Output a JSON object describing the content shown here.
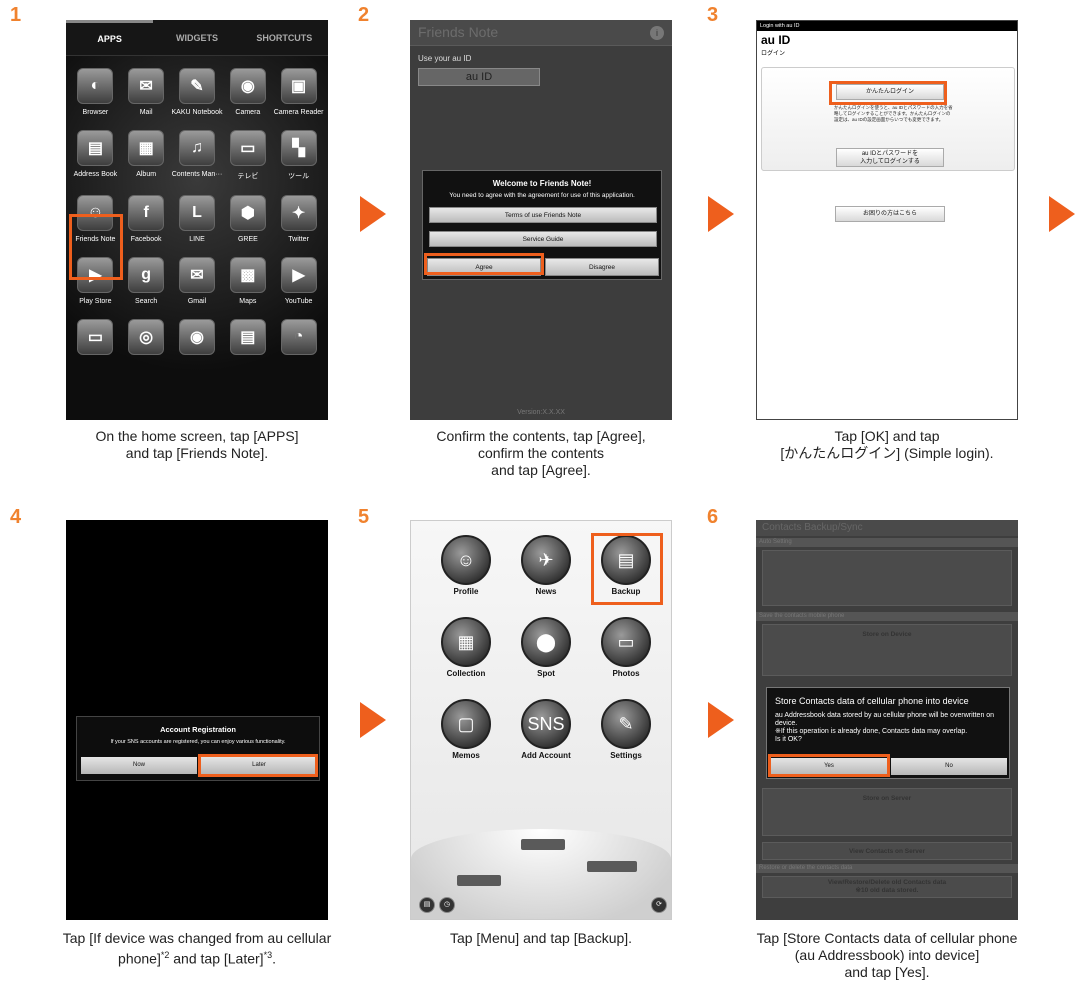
{
  "steps": [
    {
      "num": "1",
      "caption": [
        "On the home screen, tap [APPS]",
        "and tap [Friends Note]."
      ]
    },
    {
      "num": "2",
      "caption": [
        "Confirm the contents, tap [Agree],",
        "confirm the contents",
        "and tap [Agree]."
      ]
    },
    {
      "num": "3",
      "caption": [
        "Tap [OK] and tap",
        "[かんたんログイン] (Simple login)."
      ]
    },
    {
      "num": "4",
      "caption_a": "Tap [If device was changed from au cellular",
      "caption_b1": "phone]",
      "sup1": "*2",
      "caption_b2": " and tap [Later]",
      "sup2": "*3",
      "caption_b3": "."
    },
    {
      "num": "5",
      "caption": [
        "Tap [Menu] and tap [Backup]."
      ]
    },
    {
      "num": "6",
      "caption": [
        "Tap [Store Contacts data of cellular phone",
        "(au Addressbook) into device]",
        "and tap [Yes]."
      ]
    }
  ],
  "s1": {
    "tabs": [
      "APPS",
      "WIDGETS",
      "SHORTCUTS"
    ],
    "apps": [
      {
        "label": "Browser",
        "glyph": "◐"
      },
      {
        "label": "Mail",
        "glyph": "✉"
      },
      {
        "label": "KAKU Notebook",
        "glyph": "✎"
      },
      {
        "label": "Camera",
        "glyph": "◉"
      },
      {
        "label": "Camera Reader",
        "glyph": "▣"
      },
      {
        "label": "Address Book",
        "glyph": "▤"
      },
      {
        "label": "Album",
        "glyph": "▦"
      },
      {
        "label": "Contents Man···",
        "glyph": "♫"
      },
      {
        "label": "テレビ",
        "glyph": "▭"
      },
      {
        "label": "ツール",
        "glyph": "▚"
      },
      {
        "label": "Friends Note",
        "glyph": "☺"
      },
      {
        "label": "Facebook",
        "glyph": "f"
      },
      {
        "label": "LINE",
        "glyph": "L"
      },
      {
        "label": "GREE",
        "glyph": "⬢"
      },
      {
        "label": "Twitter",
        "glyph": "✦"
      },
      {
        "label": "Play Store",
        "glyph": "▶"
      },
      {
        "label": "Search",
        "glyph": "g"
      },
      {
        "label": "Gmail",
        "glyph": "✉"
      },
      {
        "label": "Maps",
        "glyph": "▩"
      },
      {
        "label": "YouTube",
        "glyph": "▶"
      },
      {
        "label": "",
        "glyph": "▭"
      },
      {
        "label": "",
        "glyph": "◎"
      },
      {
        "label": "",
        "glyph": "◉"
      },
      {
        "label": "",
        "glyph": "▤"
      },
      {
        "label": "",
        "glyph": "◔"
      }
    ]
  },
  "s2": {
    "title": "Friends Note",
    "info": "i",
    "use_au": "Use your au ID",
    "au_btn": "au ID",
    "dlg_title": "Welcome to Friends Note!",
    "dlg_text": "You need to agree with the agreement for use of this application.",
    "terms": "Terms of use Friends Note",
    "guide": "Service Guide",
    "agree": "Agree",
    "disagree": "Disagree",
    "version": "Version:X.X.XX"
  },
  "s3": {
    "top": "Login with au ID",
    "au": "au ID",
    "login": "ログイン",
    "simple": "かんたんログイン",
    "desc": "かんたんログインを使うと、au IDとパスワードの入力を省略してログインすることができます。かんたんログインの設定は、au IDの設定画面からいつでも変更できます。",
    "idpw1": "au IDとパスワードを",
    "idpw2": "入力してログインする",
    "help": "お困りの方はこちら"
  },
  "s4": {
    "title": "Account Registration",
    "text": "If your SNS accounts are registered, you can enjoy various functionality.",
    "now": "Now",
    "later": "Later"
  },
  "s5": {
    "items": [
      {
        "label": "Profile",
        "glyph": "☺"
      },
      {
        "label": "News",
        "glyph": "✈"
      },
      {
        "label": "Backup",
        "glyph": "▤"
      },
      {
        "label": "Collection",
        "glyph": "▦"
      },
      {
        "label": "Spot",
        "glyph": "⬤"
      },
      {
        "label": "Photos",
        "glyph": "▭"
      },
      {
        "label": "Memos",
        "glyph": "▢"
      },
      {
        "label": "Add Account",
        "glyph": "SNS"
      },
      {
        "label": "Settings",
        "glyph": "✎"
      }
    ]
  },
  "s6": {
    "title": "Contacts Backup/Sync",
    "auto": "Auto Setting",
    "save": "Save the contacts mobile phone",
    "store_device": "Store on Device",
    "store_server": "Store on Server",
    "view_server": "View Contacts on Server",
    "restore": "Restore or delete the contacts data",
    "view_restore": "View/Restore/Delete old Contacts data",
    "stored": "※10 old data stored.",
    "dlg_title": "Store Contacts data of cellular phone into device",
    "dlg_text": "au Addressbook data stored by au cellular phone will be overwritten on device.\n※If this operation is already done, Contacts data may overlap.\nIs it OK?",
    "yes": "Yes",
    "no": "No"
  }
}
